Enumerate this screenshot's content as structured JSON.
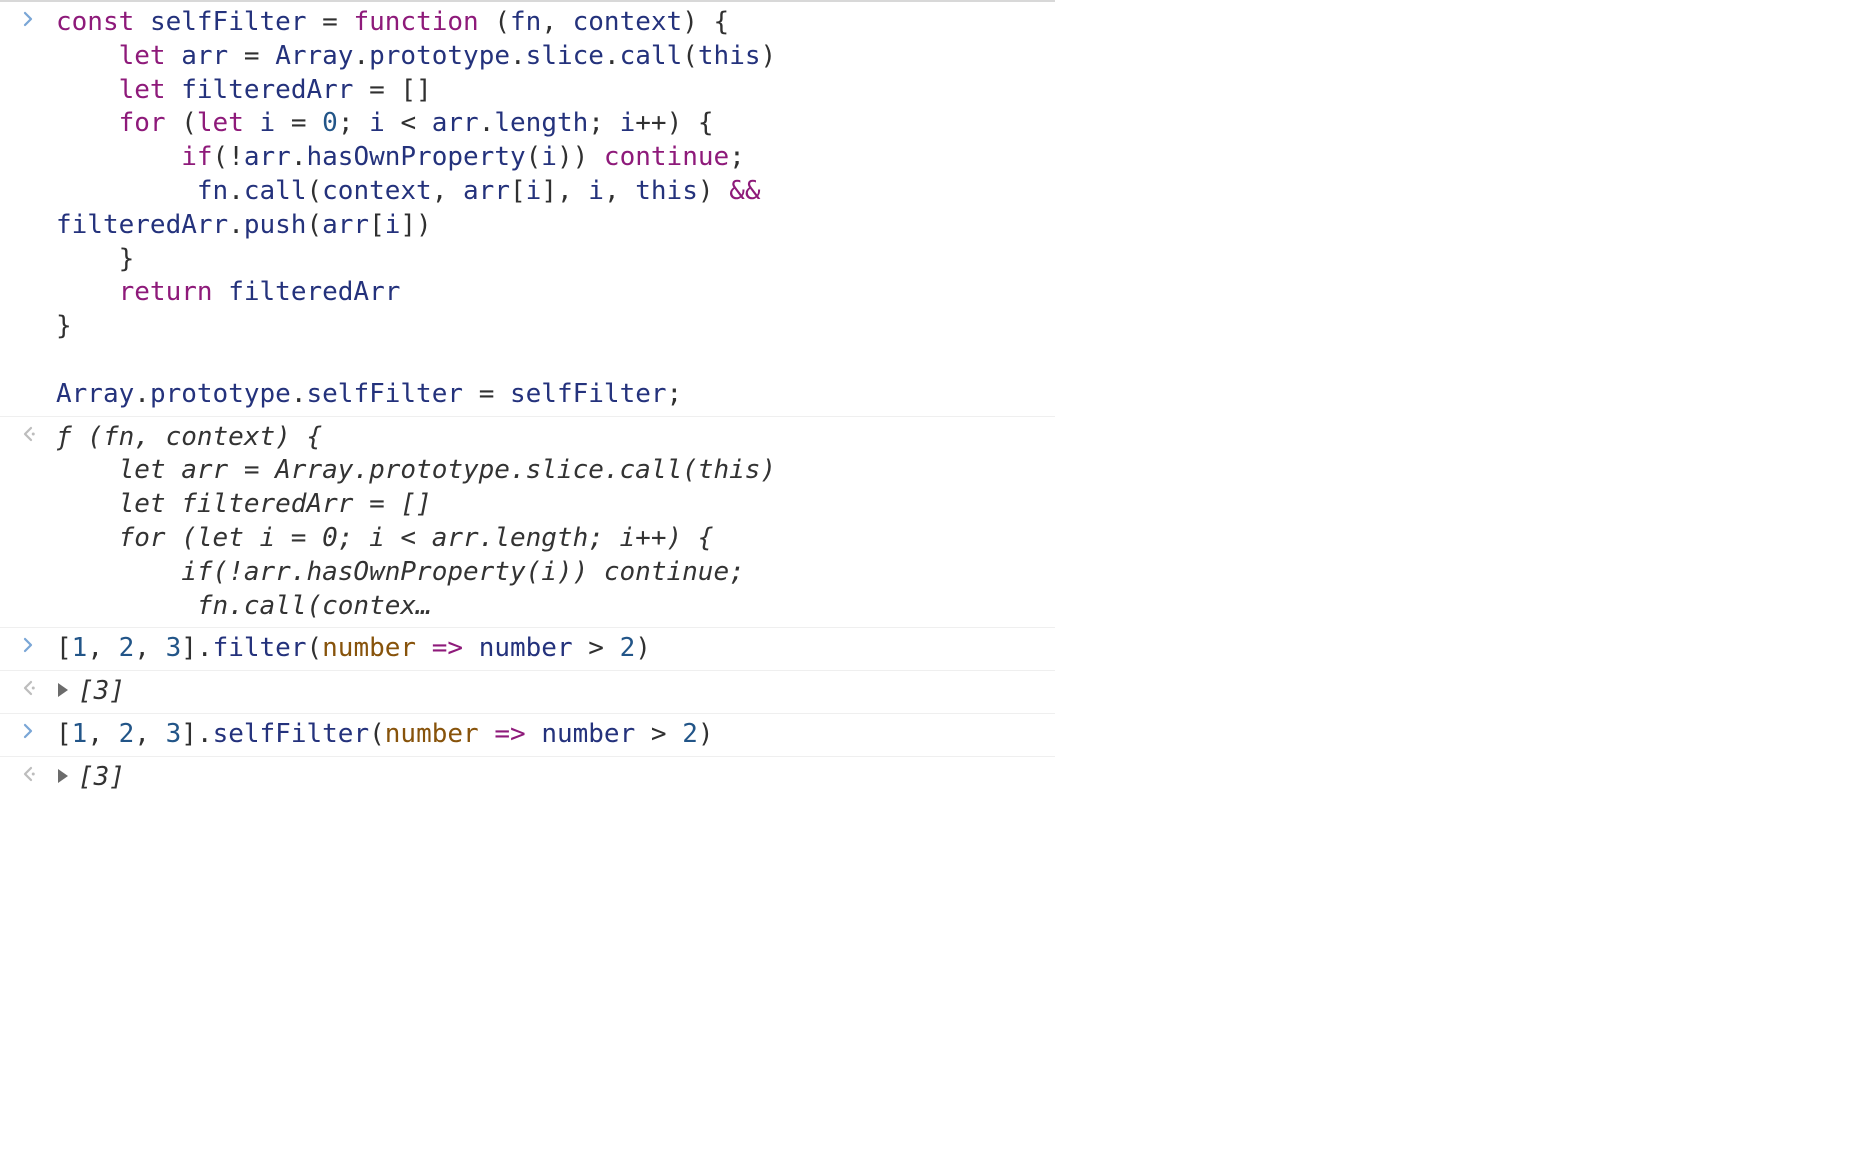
{
  "entries": [
    {
      "kind": "input",
      "code_html": "<span class='k-decl'>const</span> <span class='k-blue'>selfFilter</span> <span class='k-punc'>=</span> <span class='k-decl'>function</span> <span class='k-punc'>(</span><span class='k-blue'>fn</span><span class='k-punc'>,</span> <span class='k-blue'>context</span><span class='k-punc'>) {</span>\n    <span class='k-decl'>let</span> <span class='k-blue'>arr</span> <span class='k-punc'>=</span> <span class='k-blue'>Array</span><span class='k-punc'>.</span><span class='k-blue'>prototype</span><span class='k-punc'>.</span><span class='k-blue'>slice</span><span class='k-punc'>.</span><span class='k-blue'>call</span><span class='k-punc'>(</span><span class='k-blue'>this</span><span class='k-punc'>)</span>\n    <span class='k-decl'>let</span> <span class='k-blue'>filteredArr</span> <span class='k-punc'>= []</span>\n    <span class='k-decl'>for</span> <span class='k-punc'>(</span><span class='k-decl'>let</span> <span class='k-blue'>i</span> <span class='k-punc'>=</span> <span class='k-num'>0</span><span class='k-punc'>;</span> <span class='k-blue'>i</span> <span class='k-punc'>&lt;</span> <span class='k-blue'>arr</span><span class='k-punc'>.</span><span class='k-blue'>length</span><span class='k-punc'>;</span> <span class='k-blue'>i</span><span class='k-punc'>++) {</span>\n        <span class='k-decl'>if</span><span class='k-punc'>(!</span><span class='k-blue'>arr</span><span class='k-punc'>.</span><span class='k-blue'>hasOwnProperty</span><span class='k-punc'>(</span><span class='k-blue'>i</span><span class='k-punc'>))</span> <span class='k-decl'>continue</span><span class='k-punc'>;</span>\n         <span class='k-blue'>fn</span><span class='k-punc'>.</span><span class='k-blue'>call</span><span class='k-punc'>(</span><span class='k-blue'>context</span><span class='k-punc'>,</span> <span class='k-blue'>arr</span><span class='k-punc'>[</span><span class='k-blue'>i</span><span class='k-punc'>],</span> <span class='k-blue'>i</span><span class='k-punc'>,</span> <span class='k-blue'>this</span><span class='k-punc'>)</span> <span class='k-op'>&amp;&amp;</span>\n<span class='k-blue'>filteredArr</span><span class='k-punc'>.</span><span class='k-blue'>push</span><span class='k-punc'>(</span><span class='k-blue'>arr</span><span class='k-punc'>[</span><span class='k-blue'>i</span><span class='k-punc'>])</span>\n    <span class='k-punc'>}</span>\n    <span class='k-decl'>return</span> <span class='k-blue'>filteredArr</span>\n<span class='k-punc'>}</span>\n\n<span class='k-blue'>Array</span><span class='k-punc'>.</span><span class='k-blue'>prototype</span><span class='k-punc'>.</span><span class='k-blue'>selfFilter</span> <span class='k-punc'>=</span> <span class='k-blue'>selfFilter</span><span class='k-punc'>;</span>"
    },
    {
      "kind": "output",
      "italic": true,
      "code_html": "ƒ (fn, context) {\n    let arr = Array.prototype.slice.call(this)\n    let filteredArr = []\n    for (let i = 0; i &lt; arr.length; i++) {\n        if(!arr.hasOwnProperty(i)) continue;\n         fn.call(contex…"
    },
    {
      "kind": "input",
      "code_html": "<span class='k-punc'>[</span><span class='k-num'>1</span><span class='k-punc'>,</span> <span class='k-num'>2</span><span class='k-punc'>,</span> <span class='k-num'>3</span><span class='k-punc'>].</span><span class='k-blue'>filter</span><span class='k-punc'>(</span><span class='param'>number</span> <span class='arrow'>=&gt;</span> <span class='k-blue'>number</span> <span class='k-punc'>&gt;</span> <span class='k-num'>2</span><span class='k-punc'>)</span>"
    },
    {
      "kind": "output",
      "disclosure": true,
      "italic": true,
      "code_html": "<span class='brack'>[3]</span>"
    },
    {
      "kind": "input",
      "code_html": "<span class='k-punc'>[</span><span class='k-num'>1</span><span class='k-punc'>,</span> <span class='k-num'>2</span><span class='k-punc'>,</span> <span class='k-num'>3</span><span class='k-punc'>].</span><span class='k-blue'>selfFilter</span><span class='k-punc'>(</span><span class='param'>number</span> <span class='arrow'>=&gt;</span> <span class='k-blue'>number</span> <span class='k-punc'>&gt;</span> <span class='k-num'>2</span><span class='k-punc'>)</span>"
    },
    {
      "kind": "output",
      "disclosure": true,
      "italic": true,
      "code_html": "<span class='brack'>[3]</span>"
    }
  ],
  "icons": {
    "input_prompt": "›",
    "output_prompt": "‹"
  }
}
